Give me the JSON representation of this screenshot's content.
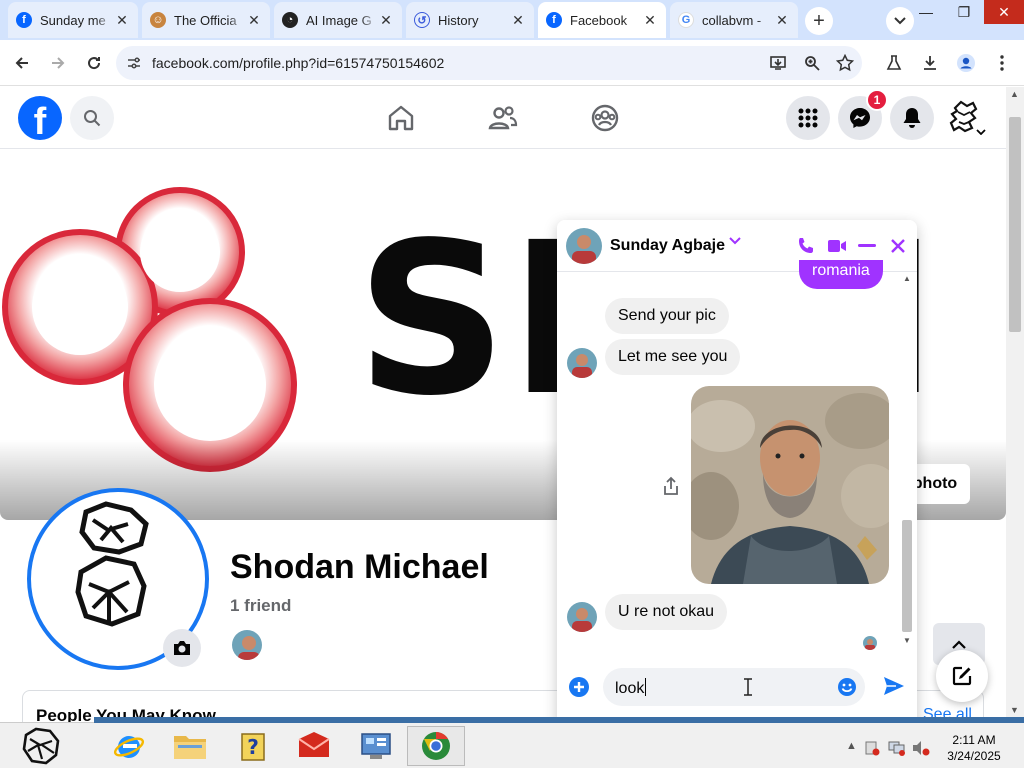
{
  "browser": {
    "tabs": [
      {
        "title": "Sunday me",
        "favicon": "facebook-icon",
        "active": false
      },
      {
        "title": "The Officia",
        "favicon": "cat-icon",
        "active": false
      },
      {
        "title": "AI Image G",
        "favicon": "ai-image-icon",
        "active": false
      },
      {
        "title": "History",
        "favicon": "history-icon",
        "active": false
      },
      {
        "title": "Facebook",
        "favicon": "facebook-icon",
        "active": true
      },
      {
        "title": "collabvm -",
        "favicon": "google-icon",
        "active": false
      }
    ],
    "new_tab_label": "+",
    "url": "facebook.com/profile.php?id=61574750154602"
  },
  "facebook": {
    "messenger_badge": "1",
    "cover_text": "SH N",
    "cover_button_label": "photo",
    "profile_name": "Shodan Michael",
    "friends_count": "1 friend",
    "people_you_may_know": "People You May Know",
    "see_all": "See all"
  },
  "chat": {
    "contact_name": "Sunday Agbaje",
    "partial_outgoing": "romania",
    "messages": [
      {
        "text": "Send your pic",
        "from": "them"
      },
      {
        "text": "Let me see you",
        "from": "them"
      },
      {
        "text": "U re not okau",
        "from": "them"
      }
    ],
    "input_value": "look",
    "accent_color": "#a033ff"
  },
  "taskbar": {
    "time": "2:11 AM",
    "date": "3/24/2025"
  }
}
